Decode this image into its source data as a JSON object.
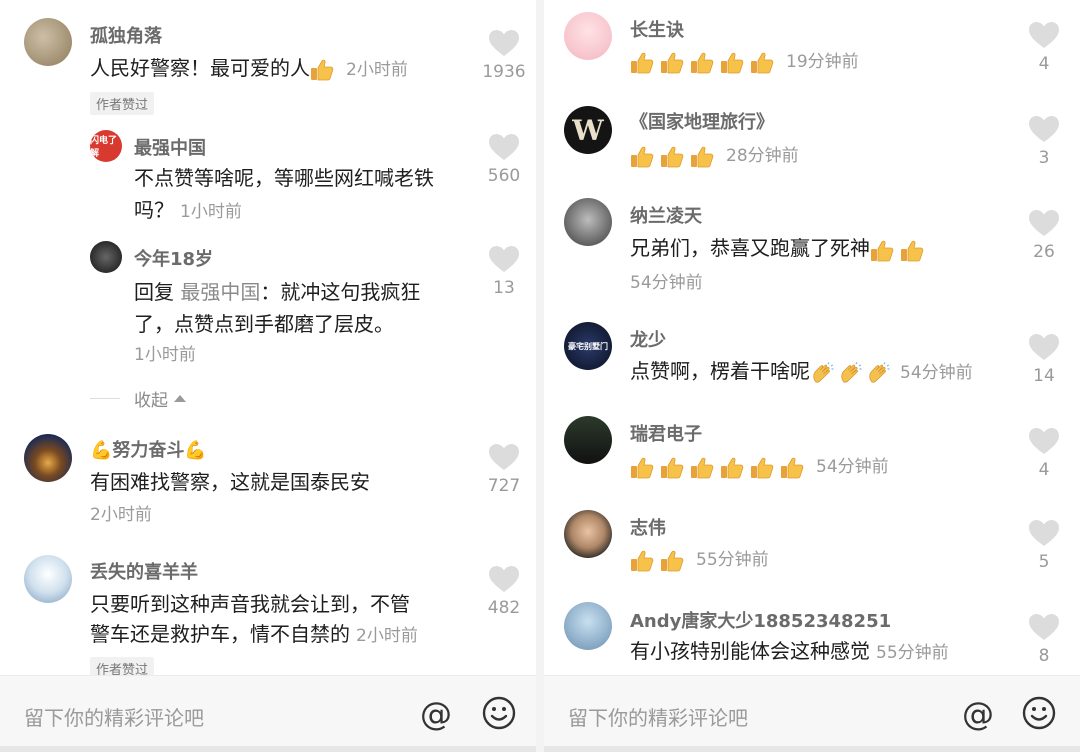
{
  "left": {
    "comments": [
      {
        "username": "孤独角落",
        "text": "人民好警察！最可爱的人",
        "time": "2小时前",
        "likes": "1936",
        "badge": "作者赞过"
      },
      {
        "username": "最强中国",
        "line1": "不点赞等啥呢，等哪些网红喊老铁",
        "line2": "吗？",
        "time": "1小时前",
        "likes": "560",
        "avatar_text": "闪电了解"
      },
      {
        "username": "今年18岁",
        "reply_prefix": "回复",
        "reply_target": "最强中国",
        "line1": "：就冲这句我疯狂",
        "line2": "了，点赞点到手都磨了层皮。",
        "time": "1小时前",
        "likes": "13"
      },
      {
        "username": "💪努力奋斗💪",
        "text": "有困难找警察，这就是国泰民安",
        "time": "2小时前",
        "likes": "727"
      },
      {
        "username": "丢失的喜羊羊",
        "line1": "只要听到这种声音我就会让到，不管",
        "line2": "警车还是救护车，情不自禁的",
        "time": "2小时前",
        "likes": "482",
        "badge": "作者赞过"
      }
    ],
    "collapse_label": "收起",
    "input_placeholder": "留下你的精彩评论吧"
  },
  "right": {
    "comments": [
      {
        "username": "长生诀",
        "thumb_count": 5,
        "time": "19分钟前",
        "likes": "4"
      },
      {
        "username": "《国家地理旅行》",
        "thumb_count": 3,
        "time": "28分钟前",
        "likes": "3",
        "avatar_text": "W"
      },
      {
        "username": "纳兰凌天",
        "text": "兄弟们，恭喜又跑赢了死神",
        "thumb_count": 2,
        "time": "54分钟前",
        "likes": "26"
      },
      {
        "username": "龙少",
        "text": "点赞啊，楞着干啥呢",
        "clap_count": 3,
        "time": "54分钟前",
        "likes": "14",
        "avatar_text": "豪宅别墅门"
      },
      {
        "username": "瑞君电子",
        "thumb_count": 6,
        "time": "54分钟前",
        "likes": "4"
      },
      {
        "username": "志伟",
        "thumb_count": 2,
        "time": "55分钟前",
        "likes": "5"
      },
      {
        "username": "Andy唐家大少18852348251",
        "text": "有小孩特别能体会这种感觉",
        "time": "55分钟前",
        "likes": "8"
      }
    ],
    "input_placeholder": "留下你的精彩评论吧"
  },
  "icons": {
    "at": "@",
    "emoji": "emoji-smile-icon",
    "heart": "heart-icon"
  },
  "colors": {
    "heart": "#d9d9d9",
    "username": "#6b6b6b",
    "time": "#9a9a9a",
    "thumb": "#f3b43b"
  }
}
